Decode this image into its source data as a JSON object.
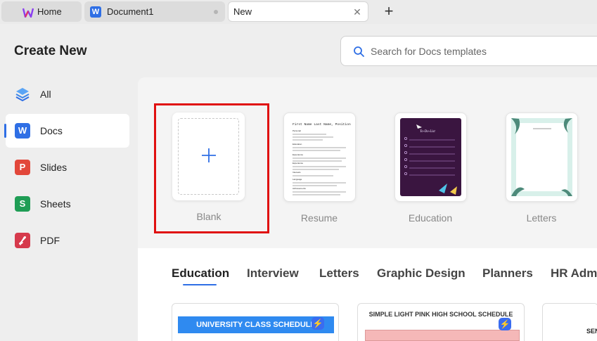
{
  "tabs": {
    "home": "Home",
    "document": "Document1",
    "new": "New"
  },
  "header": {
    "title": "Create New",
    "search_placeholder": "Search for Docs templates"
  },
  "sidebar": {
    "items": [
      {
        "label": "All",
        "icon": "layers-icon"
      },
      {
        "label": "Docs",
        "icon": "W"
      },
      {
        "label": "Slides",
        "icon": "P"
      },
      {
        "label": "Sheets",
        "icon": "S"
      },
      {
        "label": "PDF",
        "icon": "pdf-icon"
      }
    ]
  },
  "templates": [
    {
      "label": "Blank"
    },
    {
      "label": "Resume"
    },
    {
      "label": "Education"
    },
    {
      "label": "Letters"
    }
  ],
  "resume_preview": {
    "name": "First Name Last Name, Position",
    "sections": [
      "Personal",
      "Education",
      "Experience",
      "Experience",
      "Interests",
      "Language",
      "Achievements"
    ]
  },
  "education_preview": {
    "title": "To-Do-List"
  },
  "categories": [
    "Education",
    "Interview",
    "Letters",
    "Graphic Design",
    "Planners",
    "HR Adm"
  ],
  "bottom_cards": [
    {
      "title": "UNIVERSITY CLASS SCHEDULE"
    },
    {
      "title": "SIMPLE LIGHT PINK HIGH SCHOOL SCHEDULE"
    },
    {
      "title": "SEN"
    }
  ],
  "colors": {
    "accent": "#2f6fe5",
    "highlight": "#e01010",
    "docs": "#2f6fe5",
    "slides": "#e2473a",
    "sheets": "#1f9d55",
    "pdf": "#d63a4c"
  }
}
